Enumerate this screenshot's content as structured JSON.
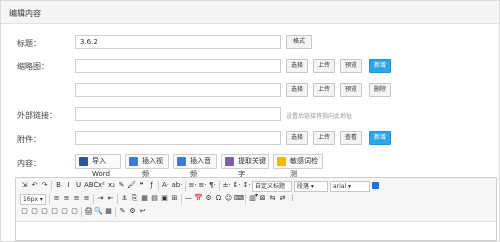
{
  "panel": {
    "title": "编辑内容"
  },
  "form": {
    "title_label": "标题：",
    "title_value": "3.6.2",
    "style_button": "格式",
    "thumb_label": "缩略图：",
    "select_button": "选择",
    "upload_button": "上传",
    "preview_button": "预览",
    "new_button": "新增",
    "delete_button": "删除",
    "link_label": "外部链接：",
    "link_hint": "设置后链接将指向此地址",
    "attach_label": "附件：",
    "view_button": "查看",
    "content_label": "内容："
  },
  "content_tools": [
    {
      "label": "导入Word",
      "icon": "word-icon",
      "color": "#2b5797"
    },
    {
      "label": "插入视频",
      "icon": "video-icon",
      "color": "#3a7bd5"
    },
    {
      "label": "插入音频",
      "icon": "audio-icon",
      "color": "#3a7bd5"
    },
    {
      "label": "提取关键字",
      "icon": "keyword-icon",
      "color": "#7b5ea7"
    },
    {
      "label": "敏感词检测",
      "icon": "sensitive-check-icon",
      "color": "#f2b705"
    }
  ],
  "editor": {
    "row1": [
      "⇲",
      "↶",
      "↷",
      "|",
      "B",
      "I",
      "U",
      "ABC",
      "x²",
      "x₂",
      "✎",
      "🖌",
      "❝",
      "ƒ",
      "|",
      "A·",
      "ab·",
      "|",
      "≡·",
      "≡·",
      "¶·",
      "|",
      "±·",
      "⇕·",
      "↕·"
    ],
    "custom_title": "自定义标题",
    "paragraph": "段落",
    "font_family": "arial",
    "row2": [
      "16px",
      "|",
      "≡",
      "≡",
      "≡",
      "≡",
      "|",
      "⇥",
      "⇤",
      "|",
      "⚓",
      "⎘",
      "▦",
      "▤",
      "▣",
      "⊞",
      "|",
      "—",
      "📅",
      "⚙",
      "Ω",
      "☺",
      "⌨",
      "|",
      "▥",
      "⊠",
      "⇆",
      "⇄",
      "⋮"
    ],
    "row3": [
      "▢",
      "▢",
      "▢",
      "▢",
      "▢",
      "▢",
      "|",
      "🖨",
      "🔍",
      "▦",
      "|",
      "✎",
      "⚙",
      "↩"
    ],
    "colors": {
      "accent": "#2ea8e5",
      "toolbar_bg": "#f6f6f6"
    }
  }
}
